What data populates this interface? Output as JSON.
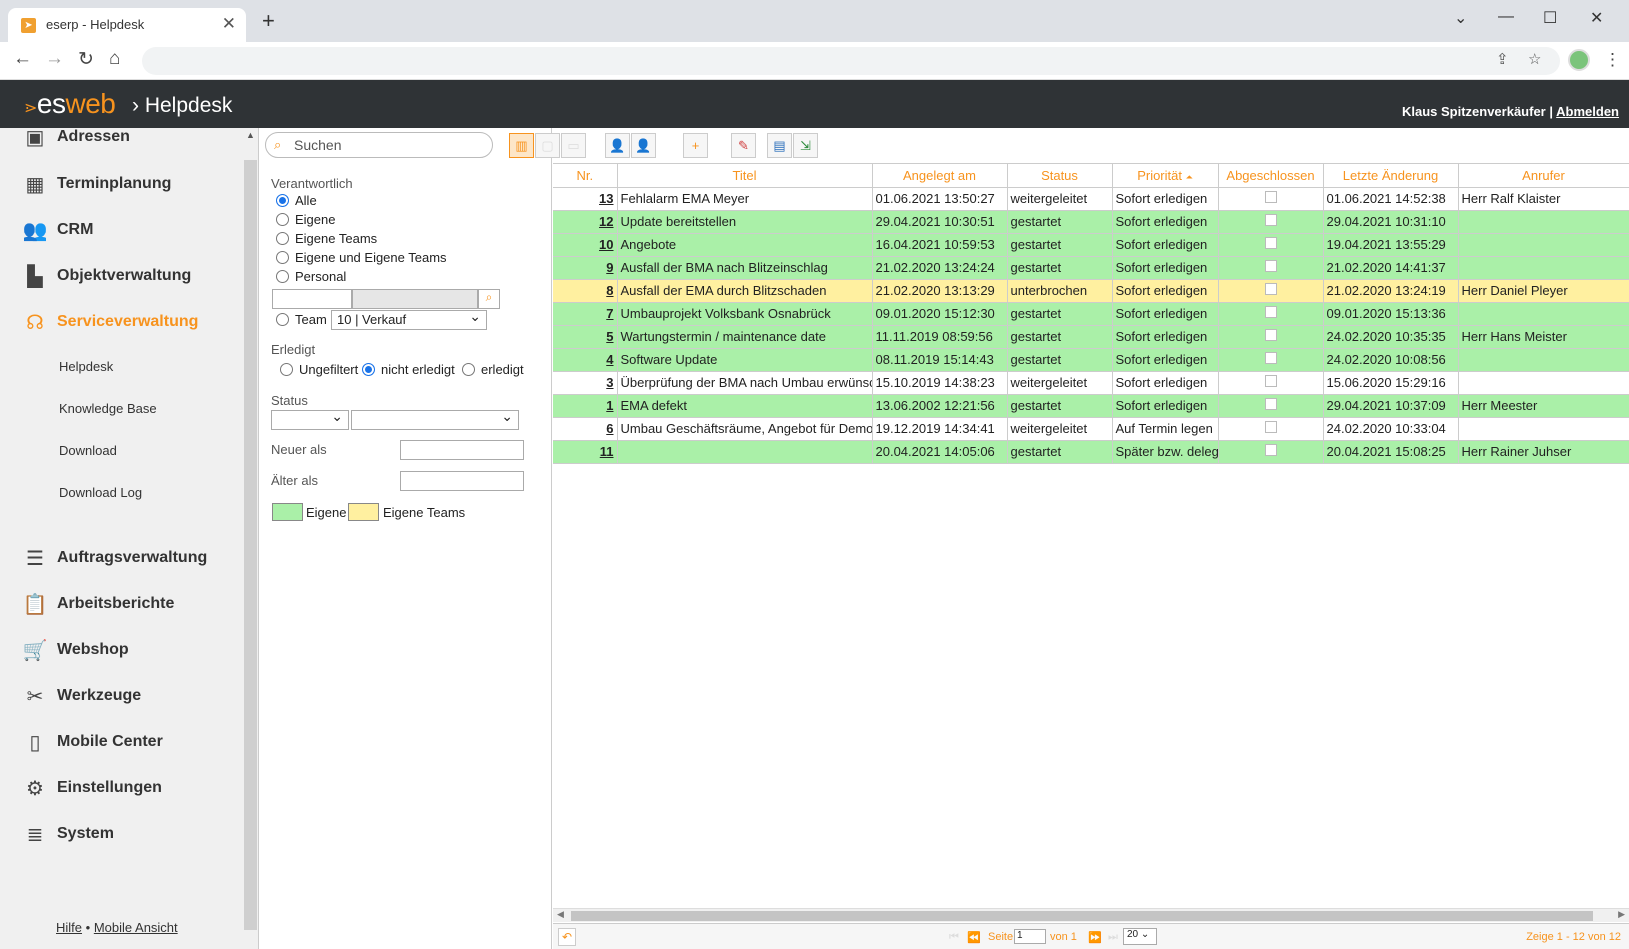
{
  "browser": {
    "tab_title": "eserp - Helpdesk",
    "new_tab": "+",
    "close": "✕"
  },
  "app": {
    "logo_prefix": "es",
    "logo_suffix": "web",
    "breadcrumb": "Helpdesk",
    "user_name": "Klaus Spitzenverkäufer",
    "separator": "|",
    "logout": "Abmelden"
  },
  "sidebar": {
    "items": [
      {
        "label": "Adressen",
        "icon": "address-card-icon"
      },
      {
        "label": "Terminplanung",
        "icon": "calendar-icon"
      },
      {
        "label": "CRM",
        "icon": "users-icon"
      },
      {
        "label": "Objektverwaltung",
        "icon": "factory-icon"
      },
      {
        "label": "Serviceverwaltung",
        "icon": "headset-icon"
      },
      {
        "label": "Auftragsverwaltung",
        "icon": "list-icon"
      },
      {
        "label": "Arbeitsberichte",
        "icon": "clipboard-icon"
      },
      {
        "label": "Webshop",
        "icon": "cart-icon"
      },
      {
        "label": "Werkzeuge",
        "icon": "tools-icon"
      },
      {
        "label": "Mobile Center",
        "icon": "mobile-icon"
      },
      {
        "label": "Einstellungen",
        "icon": "gears-icon"
      },
      {
        "label": "System",
        "icon": "database-icon"
      }
    ],
    "subitems": [
      "Helpdesk",
      "Knowledge Base",
      "Download",
      "Download Log"
    ],
    "footer_help": "Hilfe",
    "footer_dot": "•",
    "footer_mobile": "Mobile Ansicht"
  },
  "filter": {
    "search_placeholder": "Suchen",
    "responsible_label": "Verantwortlich",
    "responsible_options": [
      "Alle",
      "Eigene",
      "Eigene Teams",
      "Eigene und Eigene Teams",
      "Personal"
    ],
    "team_label": "Team",
    "team_value": "10 | Verkauf",
    "done_label": "Erledigt",
    "done_options": [
      "Ungefiltert",
      "nicht erledigt",
      "erledigt"
    ],
    "status_label": "Status",
    "newer_label": "Neuer als",
    "older_label": "Älter als",
    "legend_own": "Eigene",
    "legend_teams": "Eigene Teams"
  },
  "grid": {
    "columns": [
      "Nr.",
      "Titel",
      "Angelegt am",
      "Status",
      "Priorität",
      "Abgeschlossen",
      "Letzte Änderung",
      "Anrufer"
    ],
    "sort_arrow": "⏶",
    "rows": [
      {
        "nr": "13",
        "titel": "Fehlalarm EMA Meyer",
        "angelegt": "01.06.2021 13:50:27",
        "status": "weitergeleitet",
        "prio": "Sofort erledigen",
        "geaendert": "01.06.2021 14:52:38",
        "anrufer": "Herr Ralf Klaister",
        "color": "w"
      },
      {
        "nr": "12",
        "titel": "Update bereitstellen",
        "angelegt": "29.04.2021 10:30:51",
        "status": "gestartet",
        "prio": "Sofort erledigen",
        "geaendert": "29.04.2021 10:31:10",
        "anrufer": "",
        "color": "g"
      },
      {
        "nr": "10",
        "titel": "Angebote",
        "angelegt": "16.04.2021 10:59:53",
        "status": "gestartet",
        "prio": "Sofort erledigen",
        "geaendert": "19.04.2021 13:55:29",
        "anrufer": "",
        "color": "g"
      },
      {
        "nr": "9",
        "titel": "Ausfall der BMA nach Blitzeinschlag",
        "angelegt": "21.02.2020 13:24:24",
        "status": "gestartet",
        "prio": "Sofort erledigen",
        "geaendert": "21.02.2020 14:41:37",
        "anrufer": "",
        "color": "g"
      },
      {
        "nr": "8",
        "titel": "Ausfall der EMA durch Blitzschaden",
        "angelegt": "21.02.2020 13:13:29",
        "status": "unterbrochen",
        "prio": "Sofort erledigen",
        "geaendert": "21.02.2020 13:24:19",
        "anrufer": "Herr Daniel Pleyer",
        "color": "y"
      },
      {
        "nr": "7",
        "titel": "Umbauprojekt Volksbank Osnabrück",
        "angelegt": "09.01.2020 15:12:30",
        "status": "gestartet",
        "prio": "Sofort erledigen",
        "geaendert": "09.01.2020 15:13:36",
        "anrufer": "",
        "color": "g"
      },
      {
        "nr": "5",
        "titel": "Wartungstermin / maintenance date",
        "angelegt": "11.11.2019 08:59:56",
        "status": "gestartet",
        "prio": "Sofort erledigen",
        "geaendert": "24.02.2020 10:35:35",
        "anrufer": "Herr Hans Meister",
        "color": "g"
      },
      {
        "nr": "4",
        "titel": "Software Update",
        "angelegt": "08.11.2019 15:14:43",
        "status": "gestartet",
        "prio": "Sofort erledigen",
        "geaendert": "24.02.2020 10:08:56",
        "anrufer": "",
        "color": "g"
      },
      {
        "nr": "3",
        "titel": "Überprüfung der BMA nach Umbau erwünscht",
        "angelegt": "15.10.2019 14:38:23",
        "status": "weitergeleitet",
        "prio": "Sofort erledigen",
        "geaendert": "15.06.2020 15:29:16",
        "anrufer": "",
        "color": "w"
      },
      {
        "nr": "1",
        "titel": "EMA defekt",
        "angelegt": "13.06.2002 12:21:56",
        "status": "gestartet",
        "prio": "Sofort erledigen",
        "geaendert": "29.04.2021 10:37:09",
        "anrufer": "Herr Meester",
        "color": "g"
      },
      {
        "nr": "6",
        "titel": "Umbau Geschäftsräume, Angebot für Demo",
        "angelegt": "19.12.2019 14:34:41",
        "status": "weitergeleitet",
        "prio": "Auf Termin legen",
        "geaendert": "24.02.2020 10:33:04",
        "anrufer": "",
        "color": "w"
      },
      {
        "nr": "11",
        "titel": "",
        "angelegt": "20.04.2021 14:05:06",
        "status": "gestartet",
        "prio": "Später bzw. delegieren",
        "geaendert": "20.04.2021 15:08:25",
        "anrufer": "Herr Rainer Juhser",
        "color": "g"
      }
    ]
  },
  "pager": {
    "page_label": "Seite",
    "page_value": "1",
    "of_label": "von 1",
    "per_page": "20",
    "summary": "Zeige 1 - 12 von 12"
  },
  "colors": {
    "accent": "#f7931e",
    "own": "#aaf0a8",
    "teams": "#fff0a0",
    "header": "#2f3336"
  }
}
